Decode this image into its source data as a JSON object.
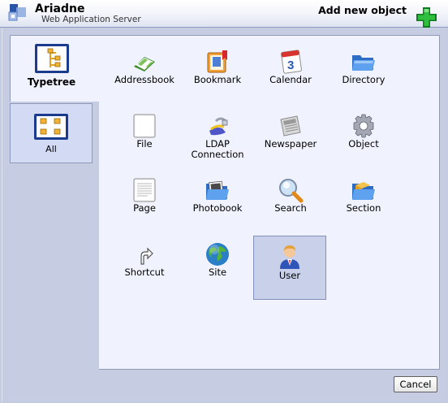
{
  "app": {
    "title": "Ariadne",
    "subtitle": "Web Application Server"
  },
  "dialog": {
    "title": "Add new object"
  },
  "tabs": [
    {
      "label": "Typetree",
      "icon": "typetree-icon",
      "active": true
    },
    {
      "label": "All",
      "icon": "grid-icon",
      "active": false
    }
  ],
  "items": [
    {
      "label": "Addressbook",
      "icon": "addressbook-icon"
    },
    {
      "label": "Bookmark",
      "icon": "bookmark-icon"
    },
    {
      "label": "Calendar",
      "icon": "calendar-icon"
    },
    {
      "label": "Directory",
      "icon": "directory-icon"
    },
    {
      "label": "File",
      "icon": "file-icon"
    },
    {
      "label": "LDAP Connection",
      "label_line1": "LDAP",
      "label_line2": "Connection",
      "icon": "ldap-icon"
    },
    {
      "label": "Newspaper",
      "icon": "newspaper-icon"
    },
    {
      "label": "Object",
      "icon": "object-icon"
    },
    {
      "label": "Page",
      "icon": "page-icon"
    },
    {
      "label": "Photobook",
      "icon": "photobook-icon"
    },
    {
      "label": "Search",
      "icon": "search-icon"
    },
    {
      "label": "Section",
      "icon": "section-icon"
    },
    {
      "label": "Shortcut",
      "icon": "shortcut-icon"
    },
    {
      "label": "Site",
      "icon": "globe-icon"
    },
    {
      "label": "User",
      "icon": "user-icon",
      "selected": true
    }
  ],
  "buttons": {
    "cancel": "Cancel"
  },
  "colors": {
    "panel_bg": "#f0f3fd",
    "frame_bg": "#c6cde3",
    "selected_bg": "#c8d0ea",
    "add_green": "#1a9e2b"
  }
}
